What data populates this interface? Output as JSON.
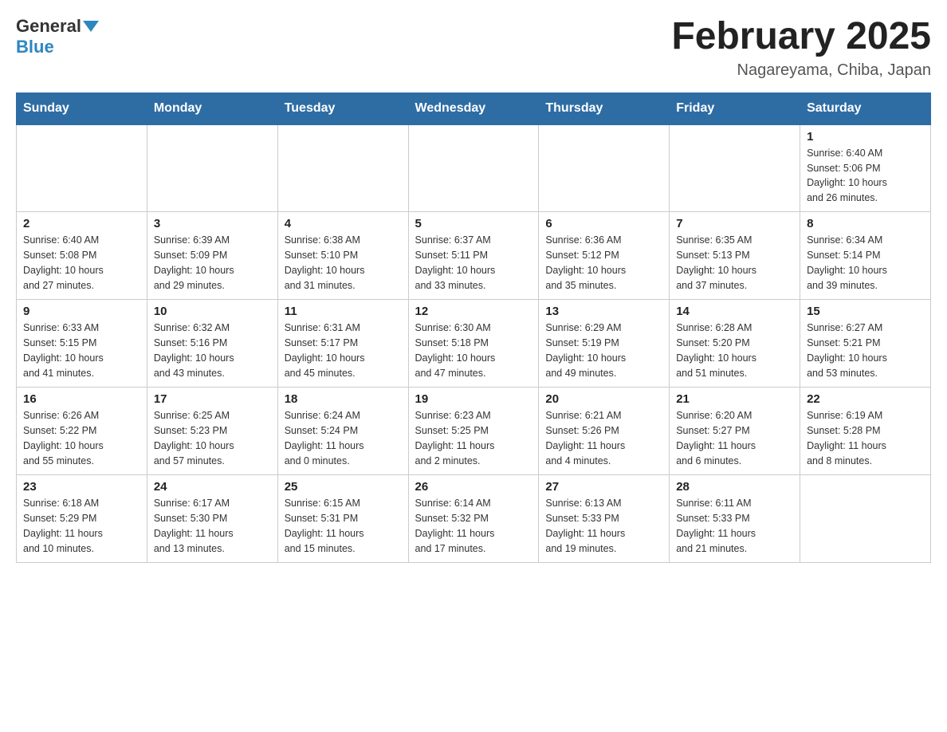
{
  "header": {
    "logo_general": "General",
    "logo_blue": "Blue",
    "title": "February 2025",
    "subtitle": "Nagareyama, Chiba, Japan"
  },
  "days_of_week": [
    "Sunday",
    "Monday",
    "Tuesday",
    "Wednesday",
    "Thursday",
    "Friday",
    "Saturday"
  ],
  "weeks": [
    [
      {
        "day": "",
        "info": ""
      },
      {
        "day": "",
        "info": ""
      },
      {
        "day": "",
        "info": ""
      },
      {
        "day": "",
        "info": ""
      },
      {
        "day": "",
        "info": ""
      },
      {
        "day": "",
        "info": ""
      },
      {
        "day": "1",
        "info": "Sunrise: 6:40 AM\nSunset: 5:06 PM\nDaylight: 10 hours\nand 26 minutes."
      }
    ],
    [
      {
        "day": "2",
        "info": "Sunrise: 6:40 AM\nSunset: 5:08 PM\nDaylight: 10 hours\nand 27 minutes."
      },
      {
        "day": "3",
        "info": "Sunrise: 6:39 AM\nSunset: 5:09 PM\nDaylight: 10 hours\nand 29 minutes."
      },
      {
        "day": "4",
        "info": "Sunrise: 6:38 AM\nSunset: 5:10 PM\nDaylight: 10 hours\nand 31 minutes."
      },
      {
        "day": "5",
        "info": "Sunrise: 6:37 AM\nSunset: 5:11 PM\nDaylight: 10 hours\nand 33 minutes."
      },
      {
        "day": "6",
        "info": "Sunrise: 6:36 AM\nSunset: 5:12 PM\nDaylight: 10 hours\nand 35 minutes."
      },
      {
        "day": "7",
        "info": "Sunrise: 6:35 AM\nSunset: 5:13 PM\nDaylight: 10 hours\nand 37 minutes."
      },
      {
        "day": "8",
        "info": "Sunrise: 6:34 AM\nSunset: 5:14 PM\nDaylight: 10 hours\nand 39 minutes."
      }
    ],
    [
      {
        "day": "9",
        "info": "Sunrise: 6:33 AM\nSunset: 5:15 PM\nDaylight: 10 hours\nand 41 minutes."
      },
      {
        "day": "10",
        "info": "Sunrise: 6:32 AM\nSunset: 5:16 PM\nDaylight: 10 hours\nand 43 minutes."
      },
      {
        "day": "11",
        "info": "Sunrise: 6:31 AM\nSunset: 5:17 PM\nDaylight: 10 hours\nand 45 minutes."
      },
      {
        "day": "12",
        "info": "Sunrise: 6:30 AM\nSunset: 5:18 PM\nDaylight: 10 hours\nand 47 minutes."
      },
      {
        "day": "13",
        "info": "Sunrise: 6:29 AM\nSunset: 5:19 PM\nDaylight: 10 hours\nand 49 minutes."
      },
      {
        "day": "14",
        "info": "Sunrise: 6:28 AM\nSunset: 5:20 PM\nDaylight: 10 hours\nand 51 minutes."
      },
      {
        "day": "15",
        "info": "Sunrise: 6:27 AM\nSunset: 5:21 PM\nDaylight: 10 hours\nand 53 minutes."
      }
    ],
    [
      {
        "day": "16",
        "info": "Sunrise: 6:26 AM\nSunset: 5:22 PM\nDaylight: 10 hours\nand 55 minutes."
      },
      {
        "day": "17",
        "info": "Sunrise: 6:25 AM\nSunset: 5:23 PM\nDaylight: 10 hours\nand 57 minutes."
      },
      {
        "day": "18",
        "info": "Sunrise: 6:24 AM\nSunset: 5:24 PM\nDaylight: 11 hours\nand 0 minutes."
      },
      {
        "day": "19",
        "info": "Sunrise: 6:23 AM\nSunset: 5:25 PM\nDaylight: 11 hours\nand 2 minutes."
      },
      {
        "day": "20",
        "info": "Sunrise: 6:21 AM\nSunset: 5:26 PM\nDaylight: 11 hours\nand 4 minutes."
      },
      {
        "day": "21",
        "info": "Sunrise: 6:20 AM\nSunset: 5:27 PM\nDaylight: 11 hours\nand 6 minutes."
      },
      {
        "day": "22",
        "info": "Sunrise: 6:19 AM\nSunset: 5:28 PM\nDaylight: 11 hours\nand 8 minutes."
      }
    ],
    [
      {
        "day": "23",
        "info": "Sunrise: 6:18 AM\nSunset: 5:29 PM\nDaylight: 11 hours\nand 10 minutes."
      },
      {
        "day": "24",
        "info": "Sunrise: 6:17 AM\nSunset: 5:30 PM\nDaylight: 11 hours\nand 13 minutes."
      },
      {
        "day": "25",
        "info": "Sunrise: 6:15 AM\nSunset: 5:31 PM\nDaylight: 11 hours\nand 15 minutes."
      },
      {
        "day": "26",
        "info": "Sunrise: 6:14 AM\nSunset: 5:32 PM\nDaylight: 11 hours\nand 17 minutes."
      },
      {
        "day": "27",
        "info": "Sunrise: 6:13 AM\nSunset: 5:33 PM\nDaylight: 11 hours\nand 19 minutes."
      },
      {
        "day": "28",
        "info": "Sunrise: 6:11 AM\nSunset: 5:33 PM\nDaylight: 11 hours\nand 21 minutes."
      },
      {
        "day": "",
        "info": ""
      }
    ]
  ]
}
